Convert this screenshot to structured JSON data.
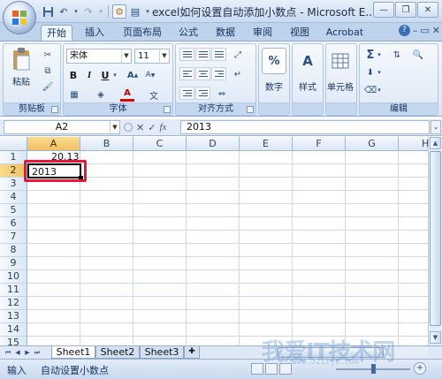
{
  "title_bar": {
    "title": "excel如何设置自动添加小数点 - Microsoft E..."
  },
  "ribbon_tabs": [
    "开始",
    "插入",
    "页面布局",
    "公式",
    "数据",
    "审阅",
    "视图",
    "Acrobat"
  ],
  "ribbon": {
    "clipboard": {
      "paste_label": "粘贴",
      "group_label": "剪贴板"
    },
    "font": {
      "font_name": "宋体",
      "font_size": "11",
      "group_label": "字体",
      "bold": "B",
      "italic": "I",
      "underline": "U"
    },
    "alignment": {
      "group_label": "对齐方式"
    },
    "number": {
      "button_label": "数字",
      "icon_text": "%"
    },
    "styles": {
      "button_label": "样式"
    },
    "cells": {
      "button_label": "单元格"
    },
    "editing": {
      "group_label": "编辑"
    }
  },
  "formula_bar": {
    "name_box": "A2",
    "fx_label": "fx",
    "value": "2013"
  },
  "grid": {
    "columns": [
      "A",
      "B",
      "C",
      "D",
      "E",
      "F",
      "G",
      "H"
    ],
    "rows": [
      "1",
      "2",
      "3",
      "4",
      "5",
      "6",
      "7",
      "8",
      "9",
      "10",
      "11",
      "12",
      "13",
      "14",
      "15"
    ],
    "cells": {
      "A1": "20.13",
      "A2": "2013"
    }
  },
  "sheet_tabs": [
    "Sheet1",
    "Sheet2",
    "Sheet3"
  ],
  "status_bar": {
    "mode": "输入",
    "macro_text": "自动设置小数点"
  },
  "watermark": {
    "text": "我爱IT技术网",
    "sub": "www.52itjs.com"
  },
  "colors": {
    "highlight_border": "#e8163c",
    "selected_header": "#f2c063"
  }
}
